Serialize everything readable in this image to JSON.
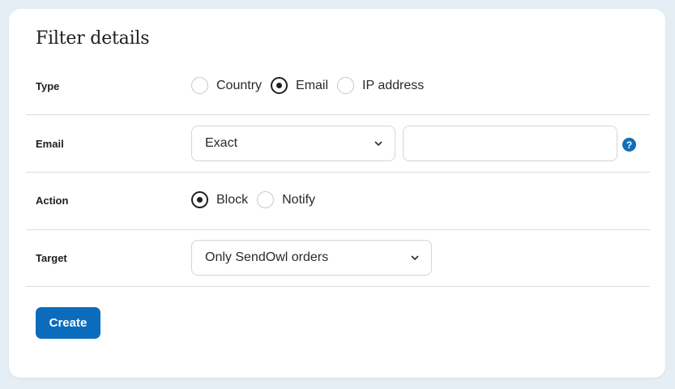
{
  "form": {
    "title": "Filter details",
    "type": {
      "label": "Type",
      "options": [
        "Country",
        "Email",
        "IP address"
      ],
      "selected": "Email"
    },
    "email": {
      "label": "Email",
      "match_select": "Exact",
      "value": ""
    },
    "action": {
      "label": "Action",
      "options": [
        "Block",
        "Notify"
      ],
      "selected": "Block"
    },
    "target": {
      "label": "Target",
      "select": "Only SendOwl orders"
    },
    "create_label": "Create"
  },
  "colors": {
    "accent": "#0b6cbd",
    "help_icon": "#0f6fb8",
    "background": "#e4eef4"
  }
}
